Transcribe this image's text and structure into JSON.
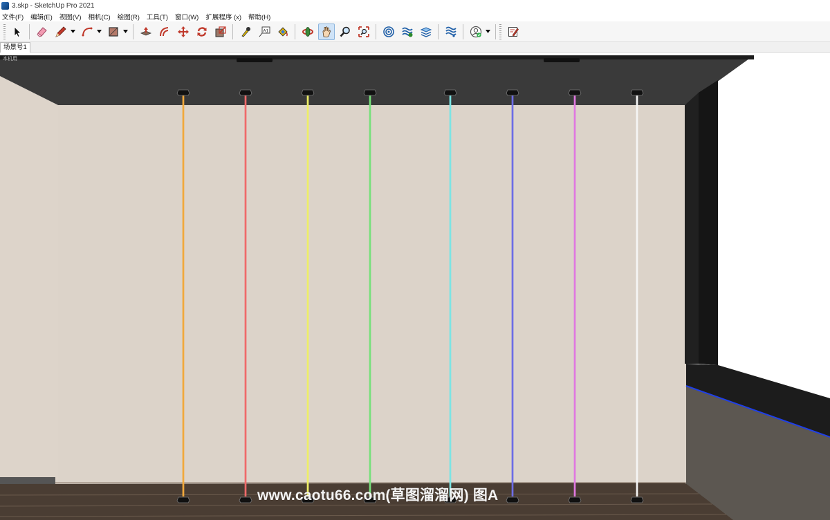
{
  "window": {
    "title": "3.skp - SketchUp Pro 2021"
  },
  "menu": [
    "文件(F)",
    "编辑(E)",
    "视图(V)",
    "相机(C)",
    "绘图(R)",
    "工具(T)",
    "窗口(W)",
    "扩展程序 (x)",
    "帮助(H)"
  ],
  "toolbar": {
    "tools": [
      "select-tool-icon",
      "eraser-tool-icon",
      "pencil-line-tool-icon",
      "arc-tool-icon",
      "rectangle-tool-icon",
      "push-pull-tool-icon",
      "offset-tool-icon",
      "move-tool-icon",
      "rotate-tool-icon",
      "scale-tool-icon",
      "tape-measure-icon",
      "text-tool-icon",
      "paint-bucket-icon",
      "orbit-icon",
      "pan-icon",
      "zoom-icon",
      "zoom-extents-icon",
      "warehouse-icon",
      "extension-warehouse-icon",
      "layers-icon",
      "components-icon",
      "account-icon",
      "sketchup-viewer-icon"
    ],
    "active_tool": "pan-icon"
  },
  "scenes": {
    "tabs": [
      "场景号1"
    ]
  },
  "viewport": {
    "scene_label": "本机用",
    "watermark": "www.caotu66.com(草图溜溜网) 图A",
    "colors": {
      "ceiling": "#3a3a3a",
      "wall": "#dcd3c9",
      "floor": "#4a3d33",
      "right_wall": "#ffffff",
      "right_floor": "#5c5751",
      "baseboard": "#1c1c1c"
    },
    "led_strip_colors": [
      "#f1a83b",
      "#ef6a6a",
      "#eeee66",
      "#77e07a",
      "#7ce4e4",
      "#6d6de6",
      "#e078e0",
      "#f5f5f5"
    ]
  }
}
